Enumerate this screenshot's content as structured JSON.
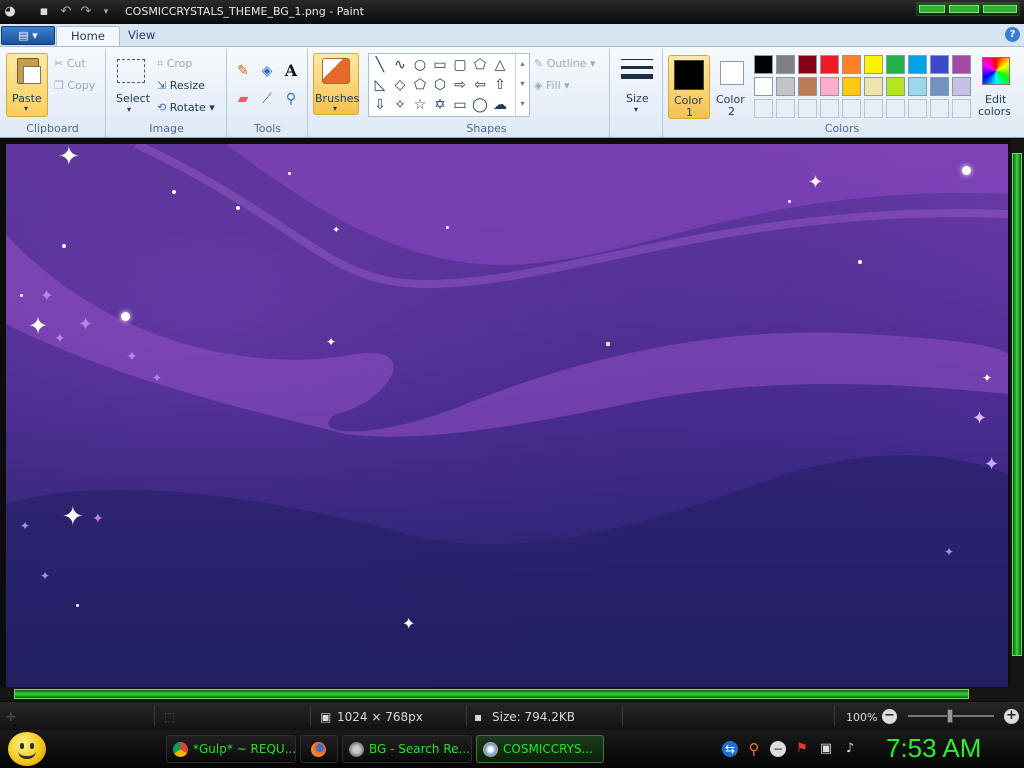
{
  "window": {
    "title": "COSMICCRYSTALS_THEME_BG_1.png - Paint"
  },
  "tabs": {
    "home": "Home",
    "view": "View"
  },
  "clipboard": {
    "label": "Clipboard",
    "paste": "Paste",
    "cut": "Cut",
    "copy": "Copy"
  },
  "image": {
    "label": "Image",
    "select": "Select",
    "crop": "Crop",
    "resize": "Resize",
    "rotate": "Rotate"
  },
  "tools": {
    "label": "Tools",
    "text_icon": "A"
  },
  "brushes": {
    "label": "Brushes"
  },
  "shapes": {
    "label": "Shapes",
    "outline": "Outline",
    "fill": "Fill"
  },
  "size": {
    "label": "Size"
  },
  "colors": {
    "label": "Colors",
    "color1_line1": "Color",
    "color1_line2": "1",
    "color2_line1": "Color",
    "color2_line2": "2",
    "edit_line1": "Edit",
    "edit_line2": "colors",
    "color1_value": "#000000",
    "color2_value": "#ffffff",
    "palette_row1": [
      "#000000",
      "#7f7f7f",
      "#880015",
      "#ed1c24",
      "#ff7f27",
      "#fff200",
      "#22b14c",
      "#00a2e8",
      "#3f48cc",
      "#a349a4"
    ],
    "palette_row2": [
      "#ffffff",
      "#c3c3c3",
      "#b97a57",
      "#ffaec9",
      "#ffc90e",
      "#efe4b0",
      "#b5e61d",
      "#99d9ea",
      "#7092be",
      "#c8bfe7"
    ]
  },
  "status": {
    "dimensions": "1024 × 768px",
    "size": "Size: 794.2KB",
    "zoom": "100%"
  },
  "taskbar": {
    "items": [
      {
        "label": "*Gulp* ~ REQU...",
        "icon": "chrome-icon"
      },
      {
        "label": "",
        "icon": "firefox-icon"
      },
      {
        "label": "BG - Search Re...",
        "icon": "search-app-icon"
      },
      {
        "label": "COSMICCRYS...",
        "icon": "paint-icon"
      }
    ],
    "clock": "7:53 AM"
  },
  "accent": {
    "green": "#2af02a",
    "ribbon": "#dfe9f5"
  }
}
